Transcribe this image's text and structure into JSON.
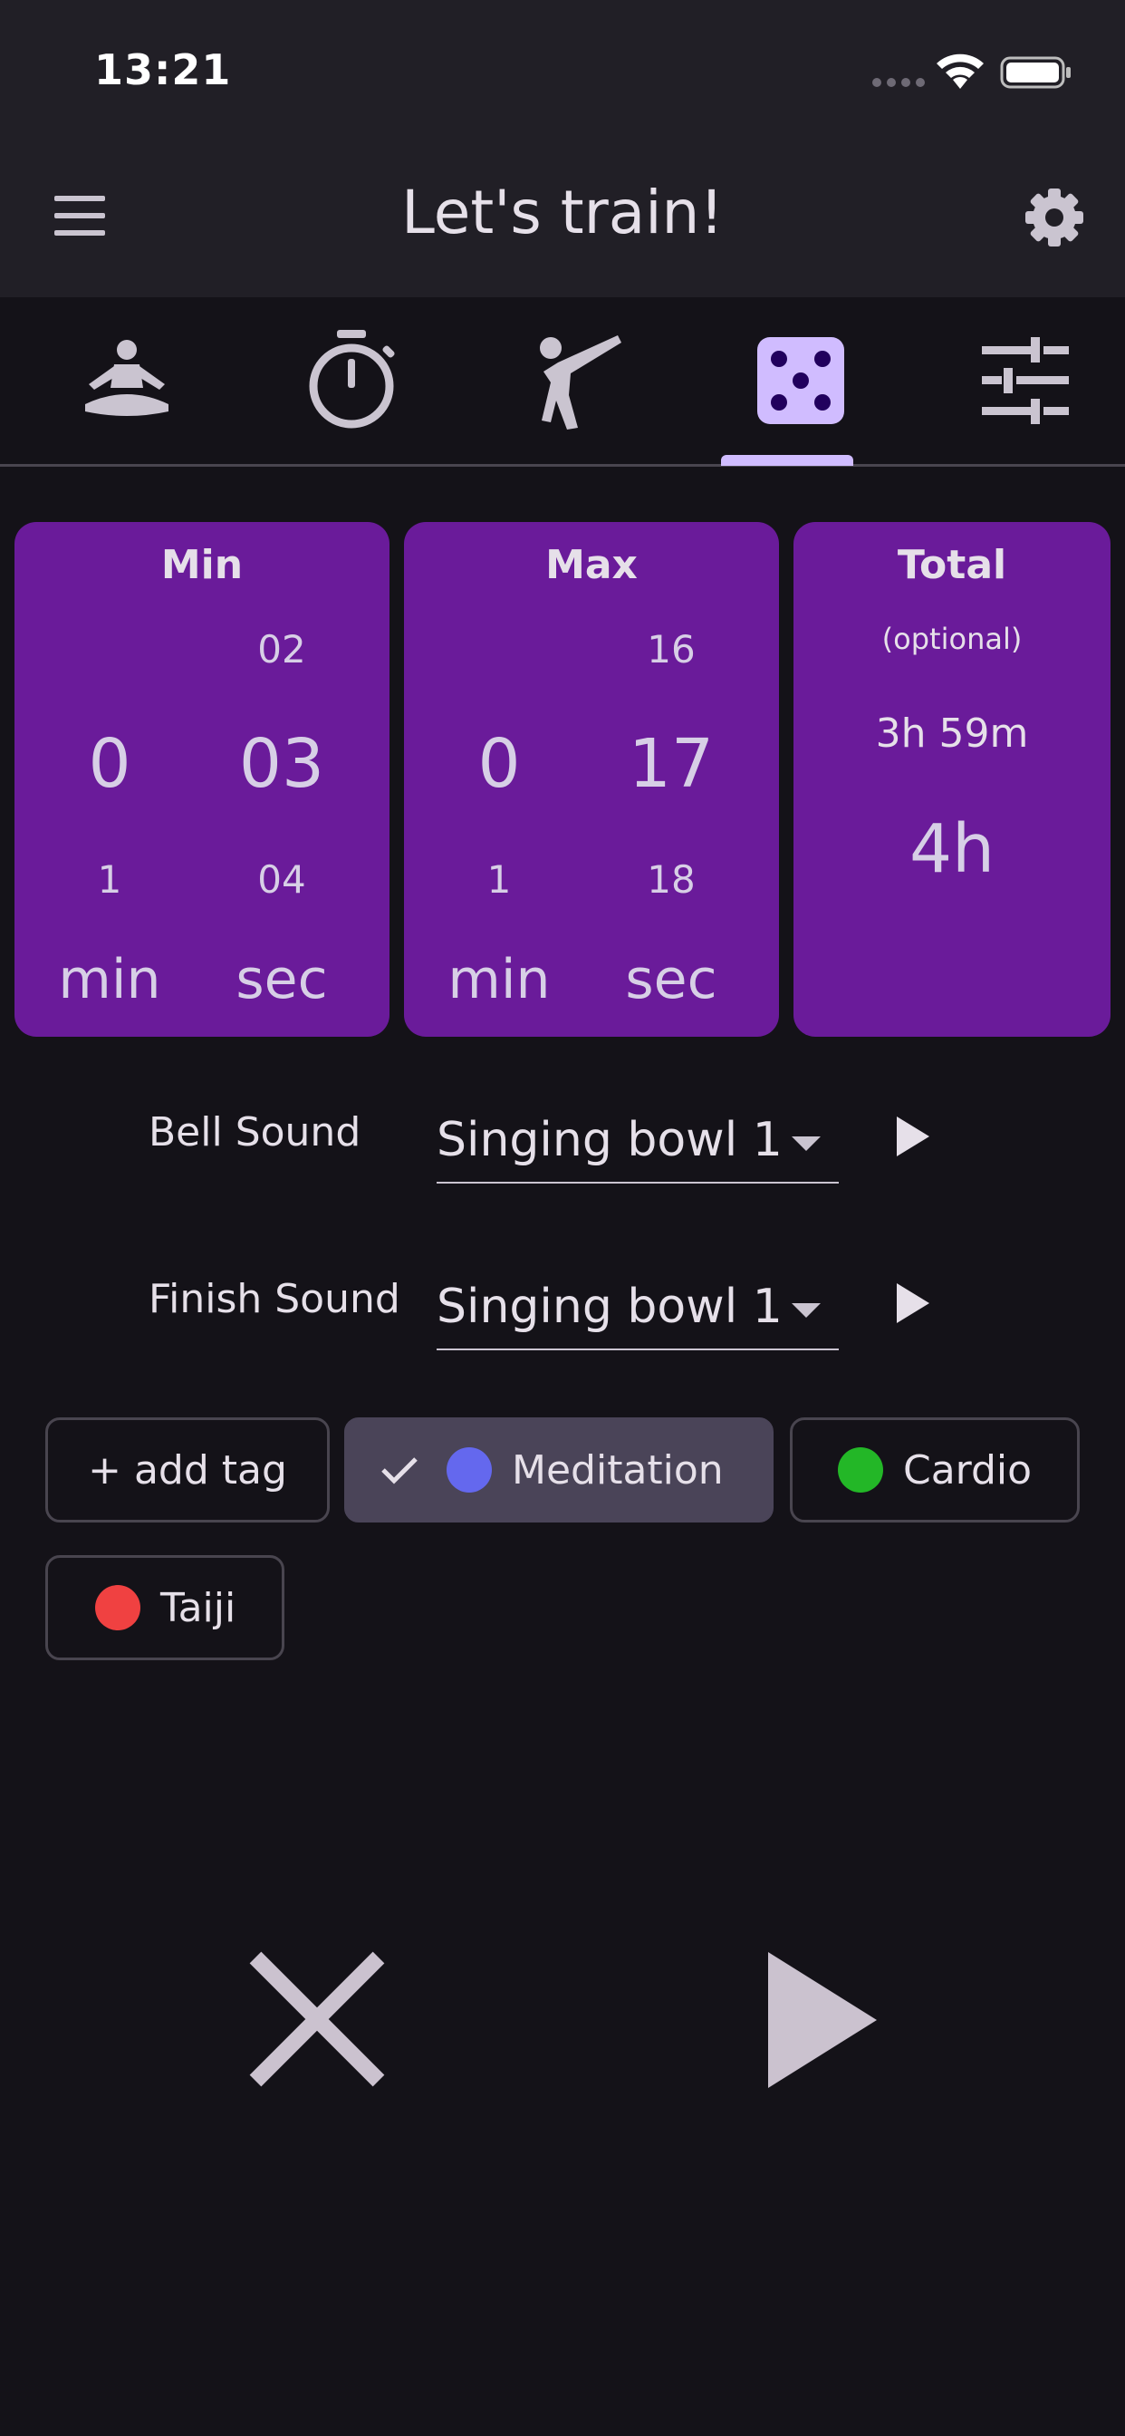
{
  "status_bar": {
    "time": "13:21"
  },
  "app_bar": {
    "title": "Let's train!"
  },
  "tabs": [
    {
      "icon": "meditation-icon",
      "label": "Meditation"
    },
    {
      "icon": "stopwatch-icon",
      "label": "Stopwatch"
    },
    {
      "icon": "martial-arts-icon",
      "label": "Martial arts"
    },
    {
      "icon": "dice-icon",
      "label": "Random",
      "selected": true
    },
    {
      "icon": "tune-icon",
      "label": "Adjust"
    }
  ],
  "min_card": {
    "title": "Min",
    "min_prev": "",
    "min_value": "0",
    "min_next": "1",
    "sec_prev": "02",
    "sec_value": "03",
    "sec_next": "04",
    "min_unit": "min",
    "sec_unit": "sec"
  },
  "max_card": {
    "title": "Max",
    "min_prev": "",
    "min_value": "0",
    "min_next": "1",
    "sec_prev": "16",
    "sec_value": "17",
    "sec_next": "18",
    "min_unit": "min",
    "sec_unit": "sec"
  },
  "total_card": {
    "title": "Total",
    "subtitle": "(optional)",
    "prev_value": "3h 59m",
    "value": "4h"
  },
  "bell_sound": {
    "label": "Bell Sound",
    "value": "Singing bowl 1"
  },
  "finish_sound": {
    "label": "Finish Sound",
    "value": "Singing bowl 1"
  },
  "tags": {
    "add_label": "+ add tag",
    "items": [
      {
        "label": "Meditation",
        "color": "#6468ee",
        "selected": true
      },
      {
        "label": "Cardio",
        "color": "#23b727",
        "selected": false
      },
      {
        "label": "Taiji",
        "color": "#f04141",
        "selected": false
      }
    ]
  },
  "colors": {
    "app_bar_bg": "#211f26",
    "background": "#141218",
    "card_bg": "#6a1b9a",
    "tab_indicator": "#d0bcff",
    "selected_chip_bg": "#4a4458"
  }
}
